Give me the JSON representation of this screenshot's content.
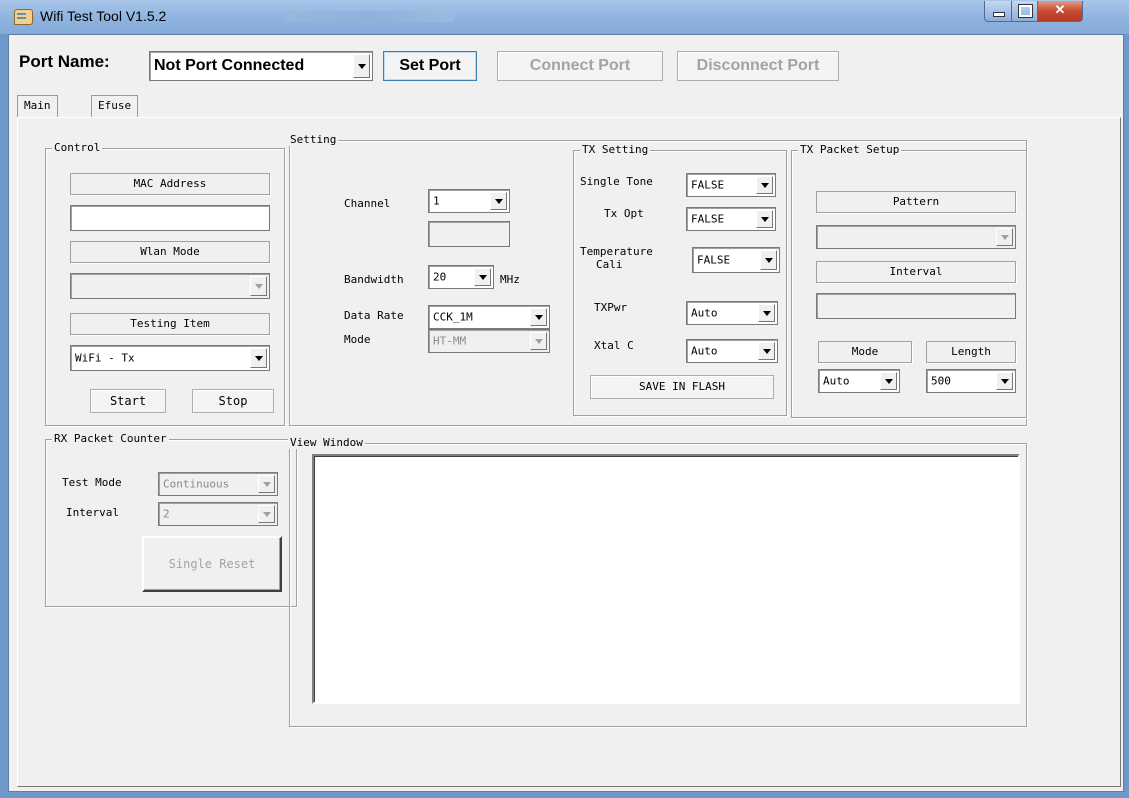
{
  "window": {
    "title": "Wifi Test Tool V1.5.2"
  },
  "toolbar": {
    "port_label": "Port Name:",
    "port_value": "Not Port Connected",
    "set_port": "Set Port",
    "connect_port": "Connect Port",
    "disconnect_port": "Disconnect Port"
  },
  "tabs": [
    {
      "label": "Main",
      "active": true
    },
    {
      "label": "Efuse",
      "active": false
    }
  ],
  "control": {
    "title": "Control",
    "mac_label": "MAC Address",
    "mac_value": "",
    "wlan_label": "Wlan Mode",
    "wlan_value": "",
    "testing_label": "Testing Item",
    "testing_value": "WiFi - Tx",
    "start": "Start",
    "stop": "Stop"
  },
  "setting": {
    "title": "Setting",
    "channel_label": "Channel",
    "channel_value": "1",
    "bandwidth_label": "Bandwidth",
    "bandwidth_value": "20",
    "bandwidth_unit": "MHz",
    "datarate_label": "Data Rate",
    "datarate_value": "CCK_1M",
    "mode_label": "Mode",
    "mode_value": "HT-MM"
  },
  "tx_setting": {
    "title": "TX Setting",
    "single_tone_label": "Single Tone",
    "single_tone_value": "FALSE",
    "tx_opt_label": "Tx Opt",
    "tx_opt_value": "FALSE",
    "temp_label_1": "Temperature",
    "temp_label_2": "Cali",
    "temp_value": "FALSE",
    "txpwr_label": "TXPwr",
    "txpwr_value": "Auto",
    "xtal_label": "Xtal C",
    "xtal_value": "Auto",
    "save_flash": "SAVE IN FLASH"
  },
  "tx_packet": {
    "title": "TX Packet Setup",
    "pattern_label": "Pattern",
    "pattern_value": "",
    "interval_label": "Interval",
    "interval_value": "",
    "mode_label": "Mode",
    "mode_value": "Auto",
    "length_label": "Length",
    "length_value": "500"
  },
  "rx_counter": {
    "title": "RX Packet Counter",
    "test_mode_label": "Test Mode",
    "test_mode_value": "Continuous",
    "interval_label": "Interval",
    "interval_value": "2",
    "single_reset": "Single Reset"
  },
  "view_window": {
    "title": "View Window",
    "content": ""
  }
}
